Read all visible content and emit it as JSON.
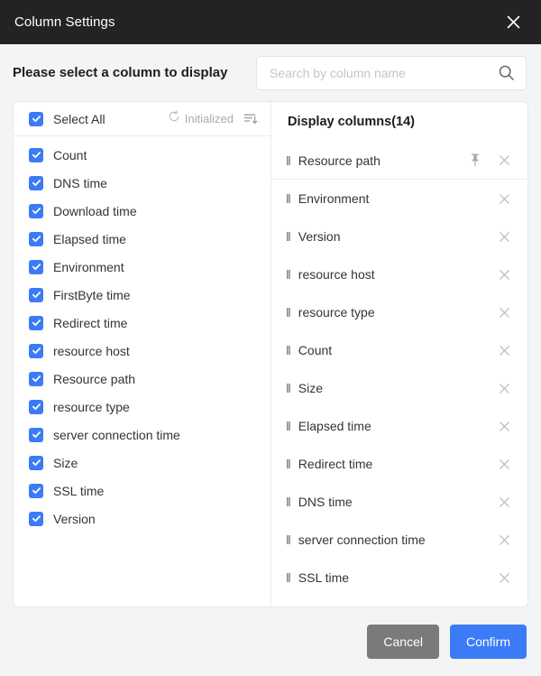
{
  "titlebar": {
    "title": "Column Settings",
    "close_icon": "close-icon"
  },
  "subheader": {
    "title": "Please select a column to display",
    "search": {
      "placeholder": "Search by column name",
      "value": "",
      "icon": "search-icon"
    }
  },
  "left_panel": {
    "select_all": {
      "label": "Select All",
      "checked": true
    },
    "reset": {
      "label": "Initialized",
      "icon": "reset-circle-icon"
    },
    "sort": {
      "icon": "sort-descending-icon"
    },
    "items": [
      {
        "label": "Count",
        "checked": true
      },
      {
        "label": "DNS time",
        "checked": true
      },
      {
        "label": "Download time",
        "checked": true
      },
      {
        "label": "Elapsed time",
        "checked": true
      },
      {
        "label": "Environment",
        "checked": true
      },
      {
        "label": "FirstByte time",
        "checked": true
      },
      {
        "label": "Redirect time",
        "checked": true
      },
      {
        "label": "resource host",
        "checked": true
      },
      {
        "label": "Resource path",
        "checked": true
      },
      {
        "label": "resource type",
        "checked": true
      },
      {
        "label": "server connection time",
        "checked": true
      },
      {
        "label": "Size",
        "checked": true
      },
      {
        "label": "SSL time",
        "checked": true
      },
      {
        "label": "Version",
        "checked": true
      }
    ]
  },
  "right_panel": {
    "title": "Display columns(14)",
    "count": 14,
    "items": [
      {
        "label": "Resource path",
        "pinned": true,
        "remove_icon": "close-icon",
        "pin_icon": "pin-icon",
        "drag_icon": "drag-handle-icon"
      },
      {
        "label": "Environment",
        "pinned": false,
        "remove_icon": "close-icon",
        "drag_icon": "drag-handle-icon"
      },
      {
        "label": "Version",
        "pinned": false,
        "remove_icon": "close-icon",
        "drag_icon": "drag-handle-icon"
      },
      {
        "label": "resource host",
        "pinned": false,
        "remove_icon": "close-icon",
        "drag_icon": "drag-handle-icon"
      },
      {
        "label": "resource type",
        "pinned": false,
        "remove_icon": "close-icon",
        "drag_icon": "drag-handle-icon"
      },
      {
        "label": "Count",
        "pinned": false,
        "remove_icon": "close-icon",
        "drag_icon": "drag-handle-icon"
      },
      {
        "label": "Size",
        "pinned": false,
        "remove_icon": "close-icon",
        "drag_icon": "drag-handle-icon"
      },
      {
        "label": "Elapsed time",
        "pinned": false,
        "remove_icon": "close-icon",
        "drag_icon": "drag-handle-icon"
      },
      {
        "label": "Redirect time",
        "pinned": false,
        "remove_icon": "close-icon",
        "drag_icon": "drag-handle-icon"
      },
      {
        "label": "DNS time",
        "pinned": false,
        "remove_icon": "close-icon",
        "drag_icon": "drag-handle-icon"
      },
      {
        "label": "server connection time",
        "pinned": false,
        "remove_icon": "close-icon",
        "drag_icon": "drag-handle-icon"
      },
      {
        "label": "SSL time",
        "pinned": false,
        "remove_icon": "close-icon",
        "drag_icon": "drag-handle-icon"
      }
    ]
  },
  "footer": {
    "cancel_label": "Cancel",
    "confirm_label": "Confirm"
  },
  "colors": {
    "titlebar_bg": "#232323",
    "accent": "#3b7cf6",
    "cancel_bg": "#7a7a7a",
    "page_bg": "#f3f4f5",
    "panel_bg": "#ffffff",
    "border": "#e8e9eb",
    "text": "#333437",
    "muted": "#a9abaf"
  }
}
